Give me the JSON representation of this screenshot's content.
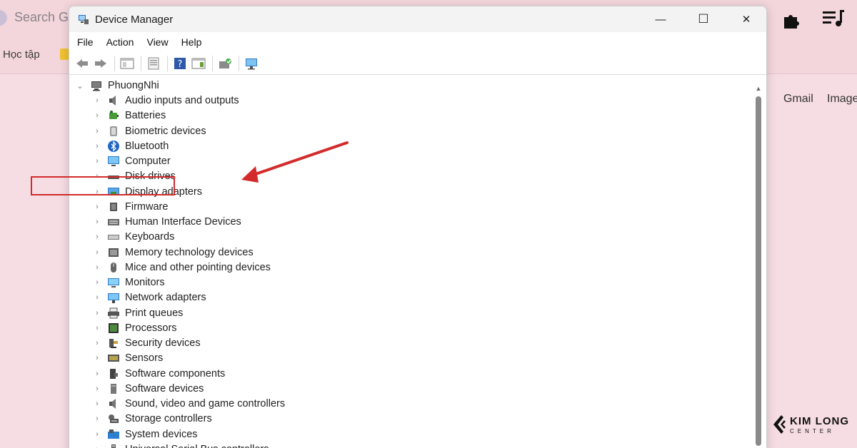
{
  "browser": {
    "search_text": "Search G",
    "bookmark_label": "Học tập",
    "links": [
      "Gmail",
      "Image"
    ]
  },
  "window": {
    "title": "Device Manager",
    "controls": {
      "minimize": "—",
      "maximize": "☐",
      "close": "✕"
    }
  },
  "menu": [
    "File",
    "Action",
    "View",
    "Help"
  ],
  "tree": {
    "root": "PhuongNhi",
    "items": [
      {
        "label": "Audio inputs and outputs",
        "icon": "speaker-icon"
      },
      {
        "label": "Batteries",
        "icon": "battery-icon"
      },
      {
        "label": "Biometric devices",
        "icon": "fingerprint-icon"
      },
      {
        "label": "Bluetooth",
        "icon": "bluetooth-icon"
      },
      {
        "label": "Computer",
        "icon": "computer-icon"
      },
      {
        "label": "Disk drives",
        "icon": "disk-icon"
      },
      {
        "label": "Display adapters",
        "icon": "display-adapter-icon"
      },
      {
        "label": "Firmware",
        "icon": "chip-icon"
      },
      {
        "label": "Human Interface Devices",
        "icon": "hid-icon"
      },
      {
        "label": "Keyboards",
        "icon": "keyboard-icon"
      },
      {
        "label": "Memory technology devices",
        "icon": "memory-icon"
      },
      {
        "label": "Mice and other pointing devices",
        "icon": "mouse-icon"
      },
      {
        "label": "Monitors",
        "icon": "monitor-icon"
      },
      {
        "label": "Network adapters",
        "icon": "network-icon"
      },
      {
        "label": "Print queues",
        "icon": "printer-icon"
      },
      {
        "label": "Processors",
        "icon": "processor-icon"
      },
      {
        "label": "Security devices",
        "icon": "security-icon"
      },
      {
        "label": "Sensors",
        "icon": "sensor-icon"
      },
      {
        "label": "Software components",
        "icon": "software-component-icon"
      },
      {
        "label": "Software devices",
        "icon": "software-device-icon"
      },
      {
        "label": "Sound, video and game controllers",
        "icon": "sound-icon"
      },
      {
        "label": "Storage controllers",
        "icon": "storage-icon"
      },
      {
        "label": "System devices",
        "icon": "system-icon"
      },
      {
        "label": "Universal Serial Bus controllers",
        "icon": "usb-icon"
      }
    ]
  },
  "annotation": {
    "highlight_color": "#d32b2b",
    "highlighted_item": "Display adapters"
  },
  "logo": {
    "top": "KIM LONG",
    "bottom": "CENTER"
  }
}
